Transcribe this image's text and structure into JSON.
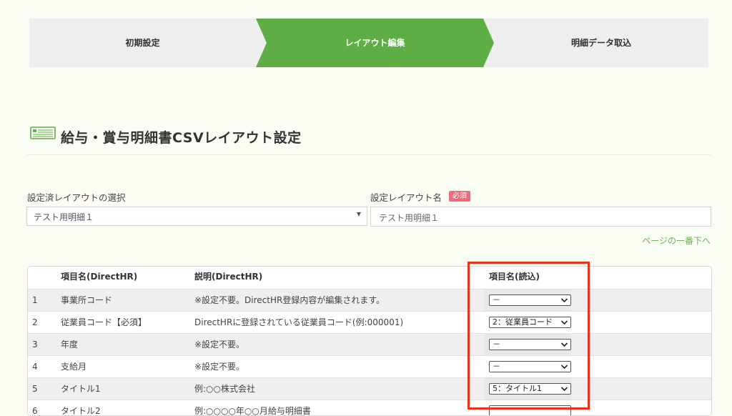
{
  "steps": [
    "初期設定",
    "レイアウト編集",
    "明細データ取込"
  ],
  "colors": {
    "accent": "#5fad45",
    "highlight": "#e8341c",
    "badge": "#f06a7e"
  },
  "page_title": "給与・賞与明細書CSVレイアウト設定",
  "title_icon": "csv-file-icon",
  "form": {
    "select_label": "設定済レイアウトの選択",
    "select_value": "テスト用明細１",
    "name_label": "設定レイアウト名",
    "required_badge": "必須",
    "name_value": "テスト用明細１"
  },
  "bottom_link": "ページの一番下へ",
  "table": {
    "headers": {
      "name": "項目名(DirectHR)",
      "desc": "説明(DirectHR)",
      "read": "項目名(読込)"
    },
    "rows": [
      {
        "num": "1",
        "name": "事業所コード",
        "desc": "※設定不要。DirectHR登録内容が編集されます。",
        "select": "－"
      },
      {
        "num": "2",
        "name": "従業員コード【必須】",
        "desc": "DirectHRに登録されている従業員コード(例:000001)",
        "select": "2：従業員コード"
      },
      {
        "num": "3",
        "name": "年度",
        "desc": "※設定不要。",
        "select": "－"
      },
      {
        "num": "4",
        "name": "支給月",
        "desc": "※設定不要。",
        "select": "－"
      },
      {
        "num": "5",
        "name": "タイトル1",
        "desc": "例:○○株式会社",
        "select": "5：タイトル1"
      },
      {
        "num": "6",
        "name": "タイトル2",
        "desc": "例:○○○○年○○月給与明細書",
        "select": ""
      }
    ]
  }
}
